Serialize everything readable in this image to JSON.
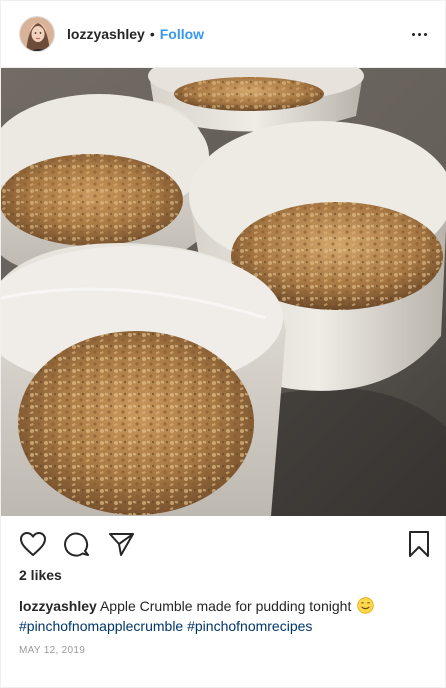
{
  "header": {
    "username": "lozzyashley",
    "separator": "•",
    "follow_label": "Follow"
  },
  "icons": {
    "avatar": "profile-avatar",
    "more": "more-options-icon",
    "like": "heart-icon",
    "comment": "comment-bubble-icon",
    "share": "paper-plane-icon",
    "save": "bookmark-icon",
    "caption_emoji": "smiling-face-emoji"
  },
  "colors": {
    "link_blue": "#3897f0",
    "hashtag": "#003569",
    "text": "#262626",
    "muted": "#999999"
  },
  "post": {
    "likes": "2 likes",
    "caption_user": "lozzyashley",
    "caption_text": "Apple Crumble made for pudding tonight",
    "hashtags": [
      "#pinchofnomapplecrumble",
      "#pinchofnomrecipes"
    ],
    "date": "MAY 12, 2019"
  }
}
